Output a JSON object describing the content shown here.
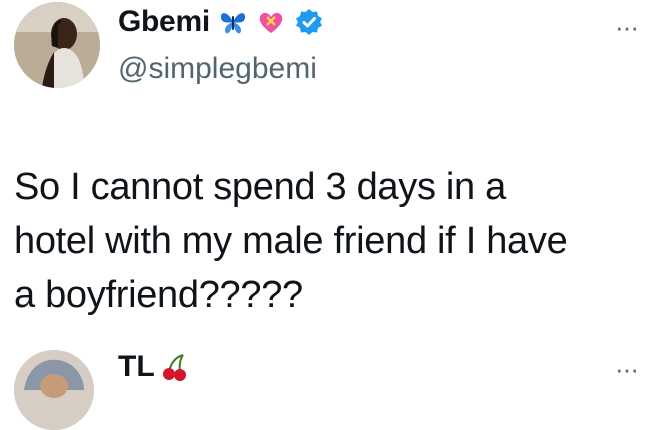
{
  "tweet": {
    "display_name": "Gbemi",
    "handle": "@simplegbemi",
    "badges": [
      "butterfly-emoji",
      "heart-with-ribbon-emoji",
      "verified-badge-icon"
    ],
    "more_label": "···",
    "text_lines": [
      "So I cannot spend 3 days in a",
      "hotel with my male friend if I have",
      "a boyfriend?????"
    ]
  },
  "reply": {
    "display_name": "TL",
    "badges": [
      "cherries-emoji"
    ],
    "more_label": "···"
  },
  "colors": {
    "text": "#0f1419",
    "secondary": "#536471",
    "verified": "#1d9bf0",
    "butterfly": "#1d6fd6",
    "heart": "#f04fa6",
    "cherry": "#d4152b"
  }
}
